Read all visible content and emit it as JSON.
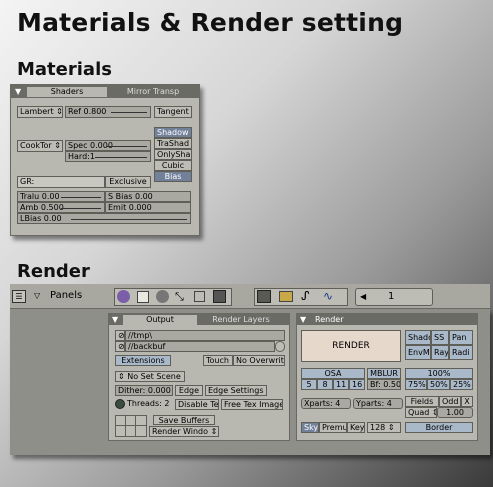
{
  "title": "Materials & Render setting",
  "materials": {
    "heading": "Materials",
    "tabs": [
      "Shaders",
      "Mirror Transp"
    ],
    "row1": {
      "diffuse": "Lambert",
      "ref": "Ref  0.800",
      "tangent": "Tangent"
    },
    "row2": {
      "spec_shader": "CookTor",
      "spec": "Spec 0.000",
      "hard": "Hard:1"
    },
    "shadow_buttons": [
      "Shadow",
      "TraShad",
      "OnlySha",
      "Cubic",
      "Bias"
    ],
    "gr": "GR:",
    "exclusive": "Exclusive",
    "params": {
      "tralu": "Tralu 0.00",
      "sbias": "S Bias 0.00",
      "amb": "Amb 0.500",
      "emit": "Emit 0.000",
      "lbias": "LBias 0.00"
    }
  },
  "render": {
    "heading": "Render",
    "toolbar": {
      "panels": "Panels",
      "frame": "1"
    },
    "output": {
      "tabs": [
        "Output",
        "Render Layers"
      ],
      "path1": "//tmp\\",
      "path2": "//backbuf",
      "extensions": "Extensions",
      "touch": "Touch",
      "no_overwrite": "No Overwrite",
      "set_scene": "No Set Scene",
      "dither": "Dither: 0.000",
      "edge": "Edge",
      "edge_settings": "Edge Settings",
      "threads": "Threads: 2",
      "disable_tex": "Disable Te",
      "free_tex": "Free Tex Image",
      "save_buffers": "Save Buffers",
      "render_window": "Render Windo"
    },
    "render_panel": {
      "title": "Render",
      "render_button": "RENDER",
      "side": [
        "Shado",
        "SS",
        "Pan",
        "EnvM",
        "Ray",
        "Radi"
      ],
      "osa": "OSA",
      "osa_values": [
        "5",
        "8",
        "11",
        "16"
      ],
      "mblur": "MBLUR",
      "bf": "Bf: 0.50",
      "percent_main": "100%",
      "percents": [
        "75%",
        "50%",
        "25%"
      ],
      "xparts": "Xparts: 4",
      "yparts": "Yparts: 4",
      "fields": "Fields",
      "odd": "Odd",
      "x": "X",
      "quad": "Quad",
      "quad_val": "1.00",
      "bottom": [
        "Sky",
        "Premul",
        "Key",
        "128"
      ],
      "border": "Border"
    }
  }
}
